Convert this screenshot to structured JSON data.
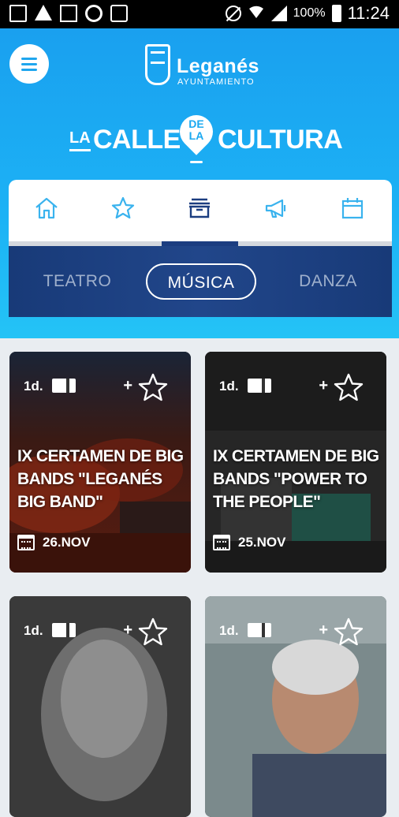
{
  "status_bar": {
    "battery": "100%",
    "time": "11:24"
  },
  "header": {
    "logo_name": "Leganés",
    "logo_sub": "AYUNTAMIENTO",
    "brand_la": "LA",
    "brand_calle": "CALLE",
    "brand_de": "DE",
    "brand_la2": "LA",
    "brand_cultura": "CULTURA"
  },
  "nav": {
    "items": [
      {
        "icon": "home-icon"
      },
      {
        "icon": "star-icon"
      },
      {
        "icon": "archive-icon",
        "active": true
      },
      {
        "icon": "megaphone-icon"
      },
      {
        "icon": "calendar-icon"
      }
    ]
  },
  "subtabs": [
    {
      "label": "TEATRO"
    },
    {
      "label": "MÚSICA",
      "active": true
    },
    {
      "label": "DANZA"
    }
  ],
  "cards": [
    {
      "duration": "1d.",
      "plus": "+",
      "title": "IX CERTAMEN DE BIG BANDS \"LEGANÉS BIG BAND\"",
      "date": "26.NOV"
    },
    {
      "duration": "1d.",
      "plus": "+",
      "title": "IX CERTAMEN DE BIG BANDS \"POWER TO THE PEOPLE\"",
      "date": "25.NOV"
    },
    {
      "duration": "1d.",
      "plus": "+",
      "title": "",
      "date": ""
    },
    {
      "duration": "1d.",
      "plus": "+",
      "title": "",
      "date": ""
    }
  ],
  "colors": {
    "header_blue": "#1aa0ef",
    "nav_dark": "#1b3d80",
    "icon_blue": "#3ab3ee"
  }
}
